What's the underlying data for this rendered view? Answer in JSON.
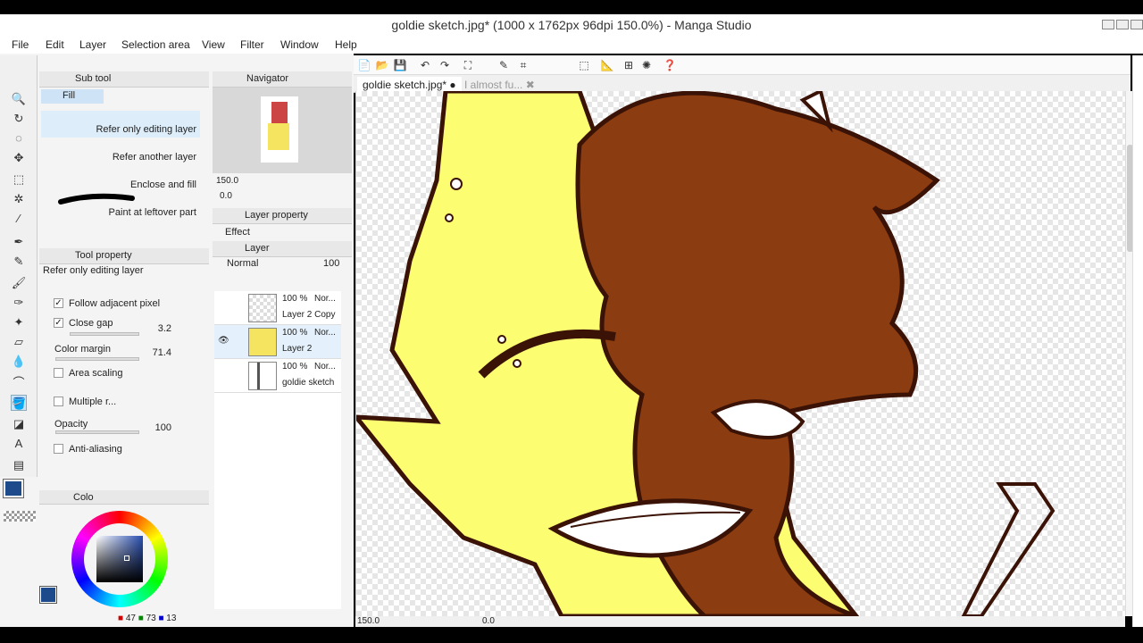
{
  "window": {
    "title": "goldie sketch.jpg* (1000 x 1762px 96dpi 150.0%)  - Manga Studio"
  },
  "menu": [
    "File",
    "Edit",
    "Layer",
    "Selection area",
    "View",
    "Filter",
    "Window",
    "Help"
  ],
  "subtool": {
    "header": "Sub tool",
    "group": "Fill",
    "items": [
      "Refer only editing layer",
      "Refer another layer",
      "Enclose and fill",
      "Paint at leftover part"
    ]
  },
  "tool_property": {
    "header": "Tool property",
    "subtitle": "Refer only editing layer",
    "follow_adjacent": "Follow adjacent pixel",
    "close_gap": "Close gap",
    "close_gap_value": "3.2",
    "color_margin": "Color margin",
    "color_margin_value": "71.4",
    "area_scaling": "Area scaling",
    "multiple_ref": "Multiple r...",
    "opacity": "Opacity",
    "opacity_value": "100",
    "anti_aliasing": "Anti-aliasing"
  },
  "color_panel": {
    "header": "Colo",
    "r": "47",
    "g": "73",
    "b": "13",
    "main_color": "#1d4a8a"
  },
  "navigator": {
    "header": "Navigator",
    "zoom": "150.0",
    "rotate": "0.0"
  },
  "layer_property": {
    "header": "Layer property",
    "effect": "Effect"
  },
  "layer_panel": {
    "header": "Layer",
    "blend": "Normal",
    "opacity": "100",
    "layers": [
      {
        "pct": "100 %",
        "mode": "Nor...",
        "name": "Layer 2 Copy"
      },
      {
        "pct": "100 %",
        "mode": "Nor...",
        "name": "Layer 2"
      },
      {
        "pct": "100 %",
        "mode": "Nor...",
        "name": "goldie sketch"
      }
    ]
  },
  "tabs": {
    "active": "goldie sketch.jpg*",
    "inactive": "I almost fu..."
  },
  "status": {
    "zoom": "150.0",
    "rotate": "0.0"
  },
  "colors": {
    "skin": "#fdfd72",
    "hair": "#8b3c10",
    "outline": "#3a1206"
  }
}
